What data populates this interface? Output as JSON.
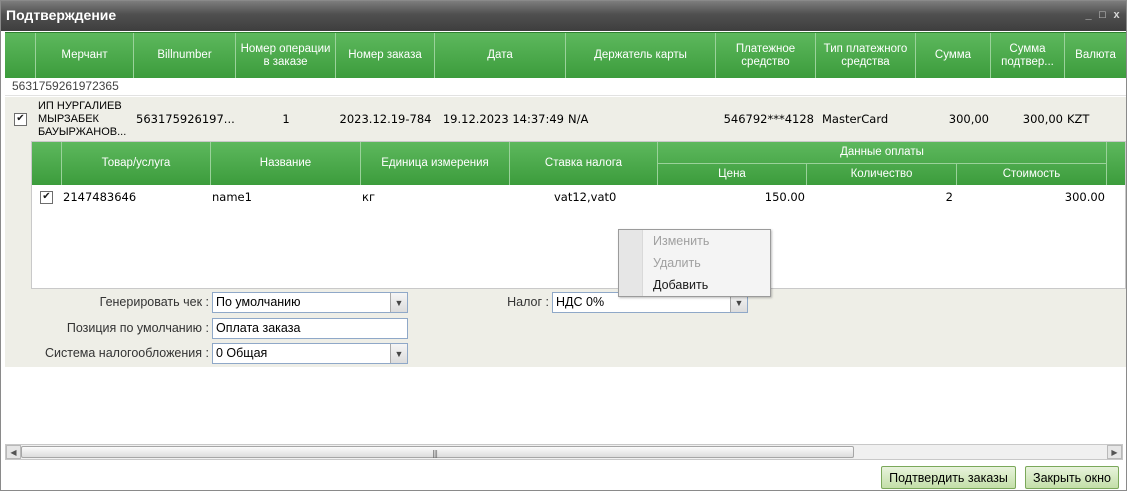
{
  "window": {
    "title": "Подтверждение",
    "controls": {
      "minimize": "_",
      "maximize": "□",
      "close": "x"
    }
  },
  "grid": {
    "columns": [
      "",
      "Мерчант",
      "Billnumber",
      "Номер операции в заказе",
      "Номер заказа",
      "Дата",
      "Держатель карты",
      "Платежное средство",
      "Тип платежного средства",
      "Сумма",
      "Сумма подтвер...",
      "Валюта"
    ],
    "group_label": "5631759261972365",
    "row": {
      "checked": true,
      "merchant": "ИП НУРГАЛИЕВ МЫРЗАБЕК БАУЫРЖАНОВ...",
      "billnumber": "563175926197...",
      "op_number": "1",
      "order_number": "2023.12.19-784",
      "date": "19.12.2023 14:37:49",
      "card_holder": "N/A",
      "payment_means": "546792***4128",
      "payment_type": "MasterCard",
      "amount": "300,00",
      "amount_confirmed": "300,00",
      "currency": "KZT"
    }
  },
  "subgrid": {
    "columns": {
      "item": "Товар/услуга",
      "name": "Название",
      "unit": "Единица измерения",
      "tax_rate": "Ставка налога",
      "payment_group": "Данные оплаты",
      "price": "Цена",
      "quantity": "Количество",
      "cost": "Стоимость"
    },
    "row": {
      "checked": true,
      "item": "2147483646",
      "name": "name1",
      "unit": "кг",
      "tax_rate": "vat12,vat0",
      "price": "150.00",
      "quantity": "2",
      "cost": "300.00"
    }
  },
  "context_menu": {
    "items": [
      "Изменить",
      "Удалить",
      "Добавить"
    ],
    "disabled": [
      true,
      true,
      false
    ]
  },
  "form": {
    "generate_receipt_label": "Генерировать чек :",
    "generate_receipt_value": "По умолчанию",
    "default_position_label": "Позиция по умолчанию :",
    "default_position_value": "Оплата заказа",
    "tax_system_label": "Система налогообложения :",
    "tax_system_value": "0 Общая",
    "tax_label": "Налог :",
    "tax_value": "НДС 0%"
  },
  "buttons": {
    "confirm": "Подтвердить заказы",
    "close": "Закрыть окно"
  },
  "colors": {
    "header_green": "#4caf50",
    "row_bg": "#eeeee7",
    "titlebar": "#4a4a4a"
  }
}
